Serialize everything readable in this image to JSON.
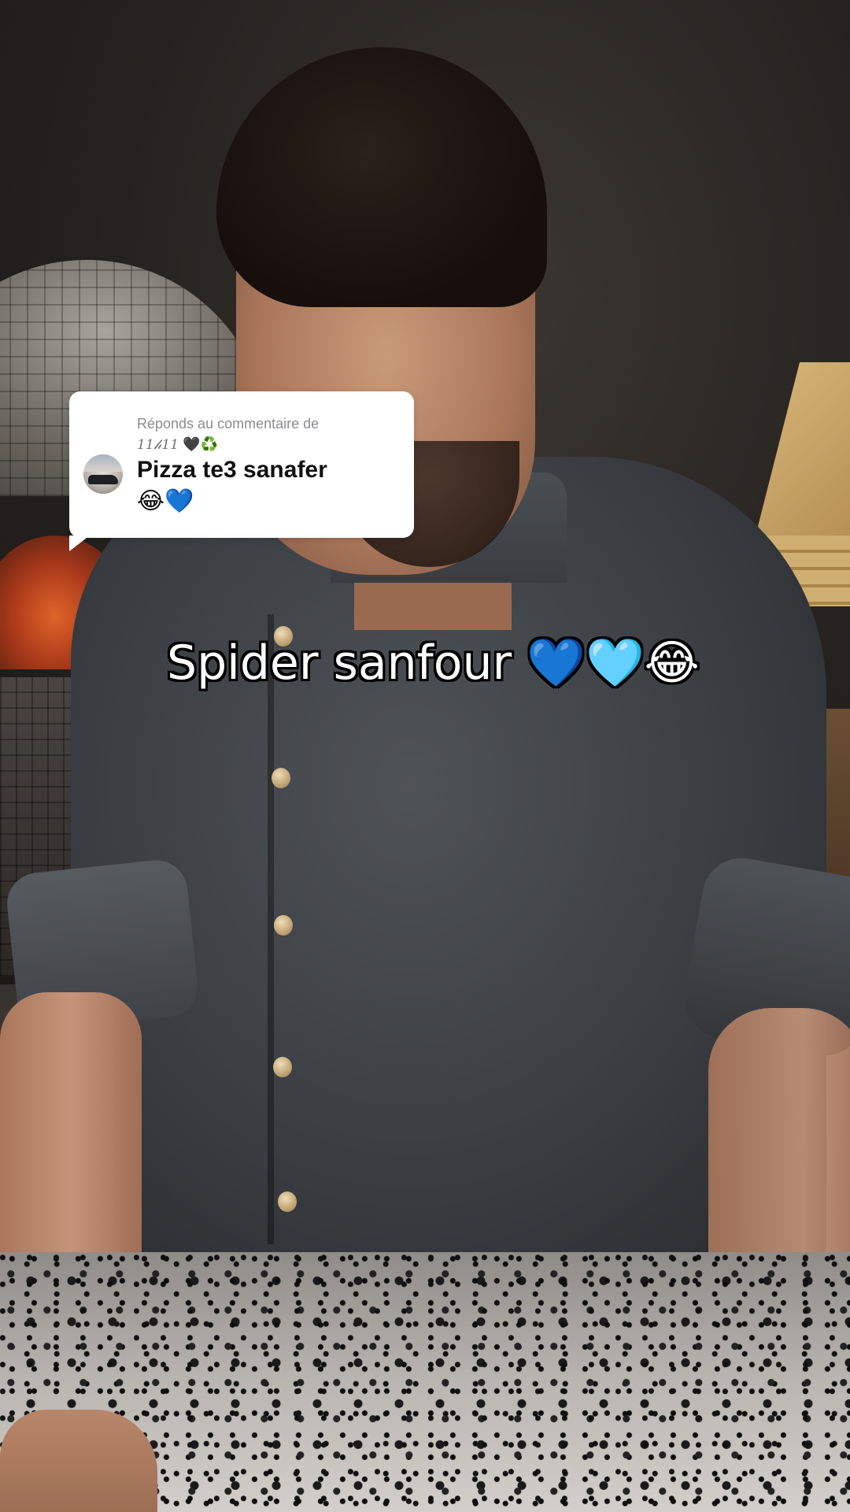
{
  "reply_sticker": {
    "header_prefix": "Réponds au commentaire de",
    "username": "11𝒽11",
    "username_emojis": "🖤♻️",
    "comment_text": "Pizza te3 sanafer",
    "comment_emojis": "😂💙"
  },
  "caption": {
    "text": "Spider sanfour",
    "emojis": "💙🩵😂"
  }
}
